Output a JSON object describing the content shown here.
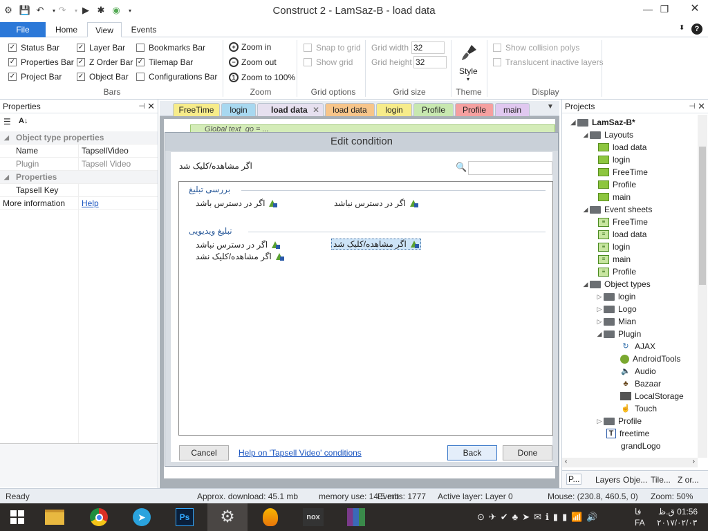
{
  "window": {
    "title": "Construct 2 - LamSaz-B - load data",
    "controls": [
      "minimize",
      "maximize",
      "close"
    ]
  },
  "menu_tabs": [
    {
      "label": "File"
    },
    {
      "label": "Home"
    },
    {
      "label": "View",
      "active": true
    },
    {
      "label": "Events"
    }
  ],
  "ribbon": {
    "bars": {
      "label": "Bars",
      "items": [
        {
          "label": "Status Bar",
          "checked": true
        },
        {
          "label": "Properties Bar",
          "checked": true
        },
        {
          "label": "Project Bar",
          "checked": true
        },
        {
          "label": "Layer Bar",
          "checked": true
        },
        {
          "label": "Z Order Bar",
          "checked": true
        },
        {
          "label": "Object Bar",
          "checked": true
        },
        {
          "label": "Bookmarks Bar",
          "checked": false
        },
        {
          "label": "Tilemap Bar",
          "checked": true
        },
        {
          "label": "Configurations Bar",
          "checked": false
        }
      ]
    },
    "zoom": {
      "label": "Zoom",
      "items": [
        "Zoom in",
        "Zoom out",
        "Zoom to 100%"
      ]
    },
    "grid_options": {
      "label": "Grid options",
      "items": [
        "Snap to grid",
        "Show grid"
      ]
    },
    "grid_size": {
      "label": "Grid size",
      "width_label": "Grid width",
      "width_value": "32",
      "height_label": "Grid height",
      "height_value": "32"
    },
    "theme": {
      "label": "Theme",
      "style_label": "Style"
    },
    "display": {
      "label": "Display",
      "items": [
        "Show collision polys",
        "Translucent inactive layers"
      ]
    }
  },
  "properties": {
    "title": "Properties",
    "header_row": "Object type properties",
    "rows": [
      {
        "key": "Name",
        "value": "TapsellVideo"
      },
      {
        "key": "Plugin",
        "value": "Tapsell Video"
      }
    ],
    "section2": "Properties",
    "rows2": [
      {
        "key": "Tapsell Key",
        "value": ""
      }
    ],
    "more_info_label": "More information",
    "more_info_link": "Help"
  },
  "doc_tabs": [
    {
      "label": "FreeTime",
      "color": "#f7ec8a"
    },
    {
      "label": "login",
      "color": "#a8d8f0"
    },
    {
      "label": "load data",
      "color": "#e6e0ef",
      "active": true
    },
    {
      "label": "load data",
      "color": "#f7c58a"
    },
    {
      "label": "login",
      "color": "#f7ec8a"
    },
    {
      "label": "Profile",
      "color": "#c8e8b0"
    },
    {
      "label": "Profile",
      "color": "#f5a0a0"
    },
    {
      "label": "main",
      "color": "#e0c8f0"
    }
  ],
  "editor": {
    "event_text": "Global text_go = ..."
  },
  "dialog": {
    "title": "Edit condition",
    "selected_title": "اگر مشاهده/کلیک شد",
    "search_placeholder": "",
    "sections": [
      {
        "title": "بررسی تبلیغ",
        "conditions": [
          "اگر در دسترس باشد",
          "اگر در دسترس نباشد"
        ]
      },
      {
        "title": "تبلیغ ویدیویی",
        "conditions": [
          "اگر در دسترس نباشد",
          "اگر مشاهده/کلیک شد",
          "اگر مشاهده/کلیک نشد"
        ]
      }
    ],
    "cancel_label": "Cancel",
    "help_link": "Help on 'Tapsell Video' conditions",
    "back_label": "Back",
    "done_label": "Done"
  },
  "projects": {
    "title": "Projects",
    "root": "LamSaz-B*",
    "layouts_label": "Layouts",
    "layouts": [
      "load data",
      "login",
      "FreeTime",
      "Profile",
      "main"
    ],
    "event_sheets_label": "Event sheets",
    "event_sheets": [
      "FreeTime",
      "load data",
      "login",
      "main",
      "Profile"
    ],
    "object_types_label": "Object types",
    "object_folders": [
      "login",
      "Logo",
      "Mian"
    ],
    "plugin_label": "Plugin",
    "plugins": [
      "AJAX",
      "AndroidTools",
      "Audio",
      "Bazaar",
      "LocalStorage",
      "Touch"
    ],
    "after_plugin": [
      "Profile"
    ],
    "objects": [
      "freetime",
      "grandLogo"
    ],
    "bottom_tabs": [
      "P...",
      "Layers",
      "Obje...",
      "Tile...",
      "Z or..."
    ]
  },
  "statusbar": {
    "ready": "Ready",
    "download": "Approx. download: 45.1 mb",
    "memory": "memory use: 14.5 mb",
    "events": "Events: 1777",
    "active_layer": "Active layer: Layer 0",
    "mouse": "Mouse: (230.8, 460.5, 0)",
    "zoom": "Zoom: 50%"
  },
  "taskbar": {
    "apps": [
      "start",
      "file-explorer",
      "chrome",
      "telegram",
      "photoshop",
      "construct",
      "fl-studio",
      "nox",
      "winrar"
    ],
    "time": "01:56 ق.ظ",
    "lang": "FA",
    "lang2": "فا",
    "date": "۲۰۱۷/۰۲/۰۳"
  }
}
